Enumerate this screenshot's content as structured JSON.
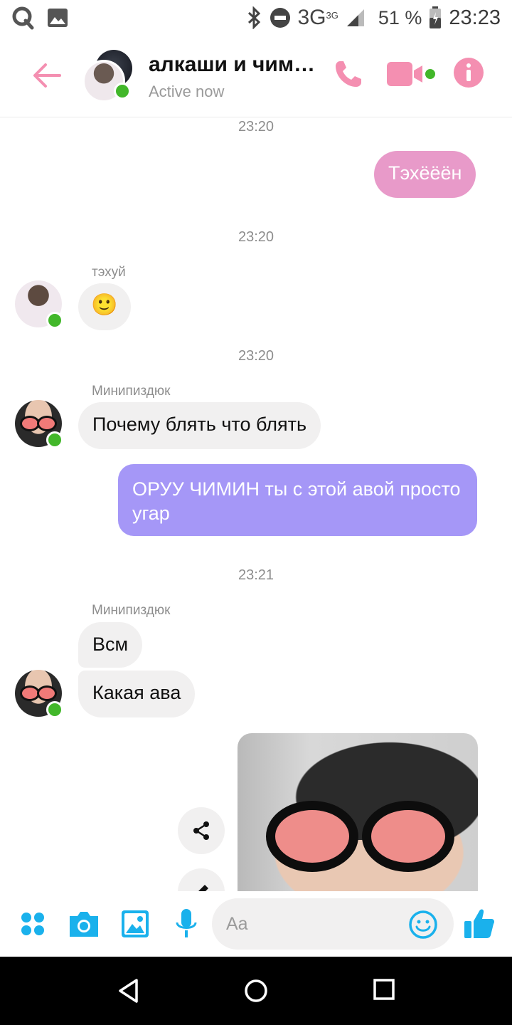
{
  "status_bar": {
    "network": "3G",
    "network_sup": "3G",
    "battery": "51 %",
    "time": "23:23",
    "icons": [
      "notification-q-icon",
      "image-icon",
      "bluetooth-icon",
      "do-not-disturb-icon",
      "signal-icon",
      "battery-icon"
    ]
  },
  "header": {
    "title": "алкаши и чим…",
    "status": "Active now",
    "accent_color": "#f48fb1"
  },
  "messages": {
    "ts1": "23:20",
    "m1": "Тэхёёён",
    "ts2": "23:20",
    "sender1": "тэхуй",
    "m2": "🙂",
    "ts3": "23:20",
    "sender2": "Минипиздюк",
    "m3": "Почему блять что блять",
    "m4": "ОРУУ ЧИМИН ты с этой авой просто угар",
    "ts4": "23:21",
    "sender3": "Минипиздюк",
    "m5": "Всм",
    "m6": "Какая ава"
  },
  "composer": {
    "placeholder": "Aa",
    "icon_color": "#1ab1ec"
  },
  "colors": {
    "outgoing_pink": "#e89ac9",
    "outgoing_purple": "#a597f7",
    "incoming": "#f1f0f0",
    "online": "#42b72a"
  }
}
